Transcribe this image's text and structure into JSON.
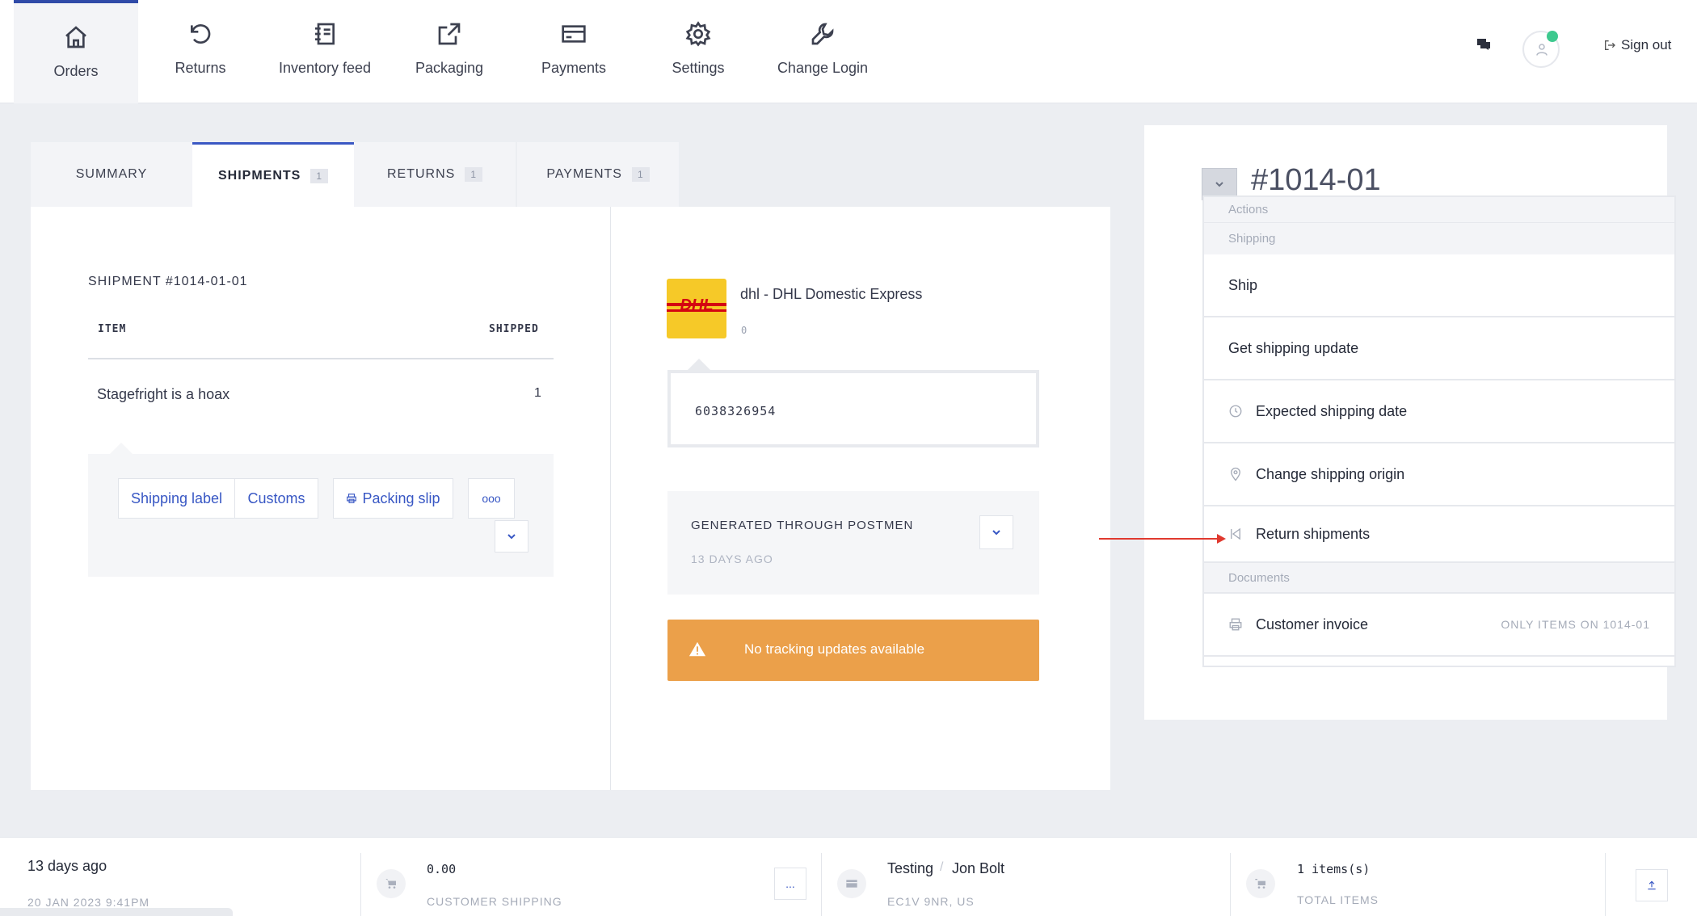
{
  "nav": {
    "items": [
      {
        "label": "Orders",
        "icon": "home-icon"
      },
      {
        "label": "Returns",
        "icon": "undo-icon"
      },
      {
        "label": "Inventory feed",
        "icon": "notebook-icon"
      },
      {
        "label": "Packaging",
        "icon": "external-link-icon"
      },
      {
        "label": "Payments",
        "icon": "credit-card-icon"
      },
      {
        "label": "Settings",
        "icon": "gear-icon"
      },
      {
        "label": "Change Login",
        "icon": "wrench-icon"
      }
    ],
    "sign_out": "Sign out"
  },
  "tabs": [
    {
      "label": "SUMMARY",
      "count": ""
    },
    {
      "label": "SHIPMENTS",
      "count": "1"
    },
    {
      "label": "RETURNS",
      "count": "1"
    },
    {
      "label": "PAYMENTS",
      "count": "1"
    }
  ],
  "shipment": {
    "title": "SHIPMENT #1014-01-01",
    "col_item": "ITEM",
    "col_shipped": "SHIPPED",
    "item_name": "Stagefright is a hoax",
    "item_qty": "1",
    "buttons": {
      "shipping_label": "Shipping label",
      "customs": "Customs",
      "packing_slip": "Packing slip",
      "more": "ooo"
    }
  },
  "carrier": {
    "logo_text": "DHL",
    "name": "dhl - DHL Domestic Express",
    "sub": "0",
    "tracking_number": "6038326954",
    "generated_title": "GENERATED THROUGH POSTMEN",
    "generated_time": "13 DAYS AGO",
    "warning": "No tracking updates available"
  },
  "order_panel": {
    "order_id": "#1014-01",
    "sections": {
      "actions": "Actions",
      "shipping": "Shipping",
      "documents": "Documents"
    },
    "items": {
      "ship": "Ship",
      "get_update": "Get shipping update",
      "expected_date": "Expected shipping date",
      "change_origin": "Change shipping origin",
      "return_shipments": "Return shipments",
      "customer_invoice": "Customer invoice",
      "invoice_note": "ONLY ITEMS ON 1014-01"
    }
  },
  "bottom": {
    "age": "13 days ago",
    "date": "20 JAN 2023 9:41PM",
    "shipping_amount": "0.00",
    "shipping_label": "CUSTOMER SHIPPING",
    "more_btn": "...",
    "customer_first": "Testing",
    "separator": "/",
    "customer_second": "Jon Bolt",
    "address": "EC1V 9NR, US",
    "items_count": "1 items(s)",
    "items_label": "TOTAL ITEMS"
  },
  "colors": {
    "accent": "#3857c4",
    "warning": "#eba04a",
    "annotation": "#e0392f",
    "online": "#3ec98f"
  }
}
